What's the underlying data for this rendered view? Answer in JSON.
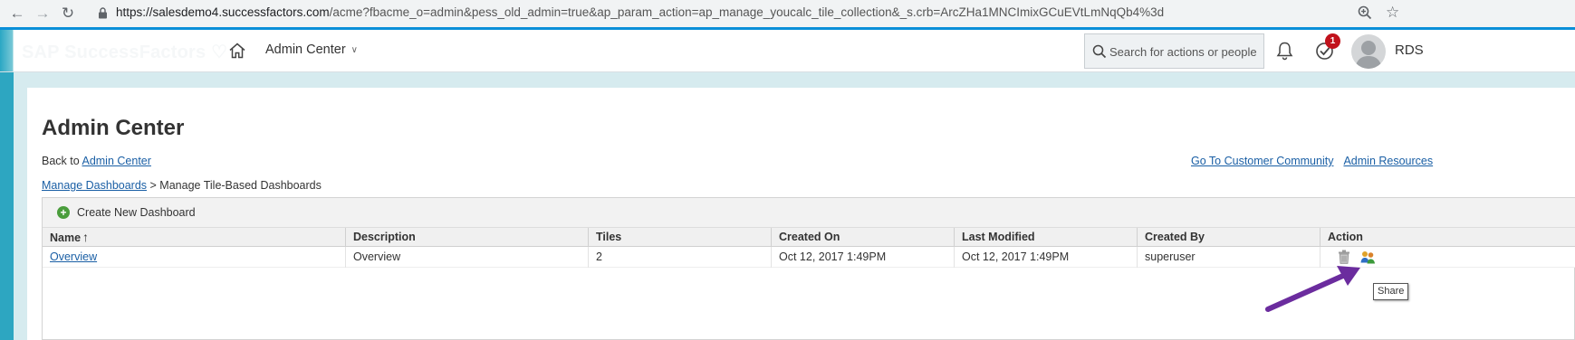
{
  "browser": {
    "url_host": "https://salesdemo4.successfactors.com",
    "url_path": "/acme?fbacme_o=admin&pess_old_admin=true&ap_param_action=ap_manage_youcalc_tile_collection&_s.crb=ArcZHa1MNCImixGCuEVtLmNqQb4%3d"
  },
  "header": {
    "logo_text": "SAP SuccessFactors",
    "menu_label": "Admin Center",
    "search_placeholder": "Search for actions or people",
    "todo_count": "1",
    "user_name": "RDS"
  },
  "page": {
    "title": "Admin Center",
    "back_prefix": "Back to ",
    "back_link": "Admin Center",
    "links": [
      "Go To Customer Community",
      "Admin Resources"
    ],
    "breadcrumb_link": "Manage Dashboards",
    "breadcrumb_sep": " > ",
    "breadcrumb_current": "Manage Tile-Based Dashboards"
  },
  "grid": {
    "create_label": "Create New Dashboard",
    "columns": [
      "Name",
      "Description",
      "Tiles",
      "Created On",
      "Last Modified",
      "Created By",
      "Action"
    ],
    "rows": [
      {
        "name": "Overview",
        "description": "Overview",
        "tiles": "2",
        "created_on": "Oct 12, 2017 1:49PM",
        "last_modified": "Oct 12, 2017 1:49PM",
        "created_by": "superuser"
      }
    ]
  },
  "tooltip": "Share",
  "colors": {
    "accent_blue": "#0a8fd8",
    "teal": "#2da6c1",
    "link": "#1a5fa5",
    "annotation_arrow": "#6b2c9e",
    "badge": "#c1121c"
  },
  "icons": [
    "back-arrow-icon",
    "forward-arrow-icon",
    "reload-icon",
    "lock-icon",
    "zoom-icon",
    "star-icon",
    "home-icon",
    "chevron-down-icon",
    "search-icon",
    "bell-icon",
    "todo-check-icon",
    "avatar",
    "plus-icon",
    "sort-up-icon",
    "trash-icon",
    "share-icon"
  ]
}
